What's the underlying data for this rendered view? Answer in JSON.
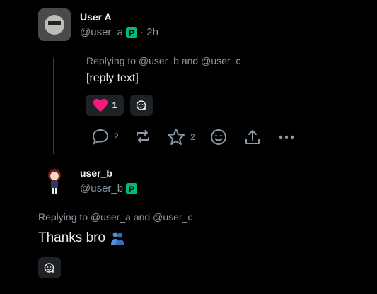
{
  "post1": {
    "display_name": "User A",
    "handle": "@user_a",
    "time": "· 2h",
    "replying_prefix": "Replying to",
    "mention_1": "@user_b",
    "and_word": "and",
    "mention_2": "@user_c",
    "body": "[reply text]",
    "reaction_count": "1",
    "reply_count": "2",
    "like_count": "2"
  },
  "post2": {
    "display_name": "user_b",
    "handle": "@user_b",
    "replying_prefix": "Replying to",
    "mention_1": "@user_a",
    "and_word": "and",
    "mention_2": "@user_c",
    "body": "Thanks bro"
  },
  "colors": {
    "background": "#000000",
    "muted": "#8b98a5",
    "heart": "#f91880",
    "badge": "#00ba7c",
    "chip": "#1e2226"
  },
  "icons": [
    "heart-icon",
    "add-reaction-icon",
    "reply-icon",
    "repost-icon",
    "like-icon",
    "emoji-icon",
    "share-icon",
    "more-icon",
    "verified-badge-icon"
  ]
}
